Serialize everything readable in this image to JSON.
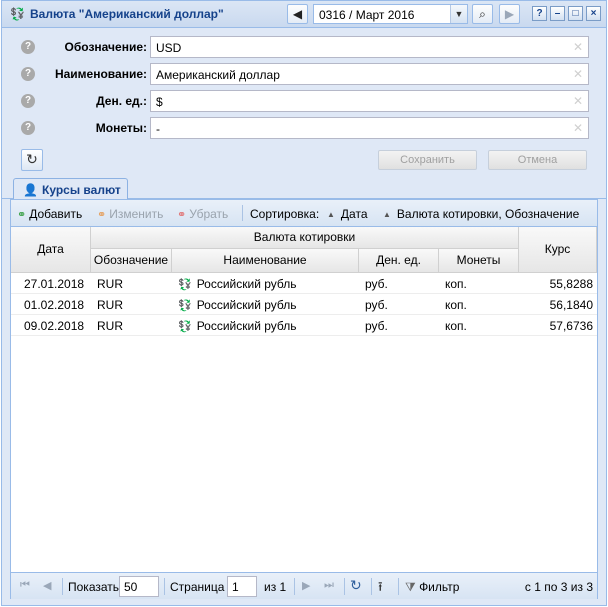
{
  "window": {
    "title": "Валюта \"Американский доллар\"",
    "period": "0316 / Март 2016"
  },
  "form": {
    "fields": [
      {
        "label": "Обозначение:",
        "value": "USD"
      },
      {
        "label": "Наименование:",
        "value": "Американский доллар"
      },
      {
        "label": "Ден. ед.:",
        "value": "$"
      },
      {
        "label": "Монеты:",
        "value": "-"
      }
    ],
    "save_label": "Сохранить",
    "cancel_label": "Отмена"
  },
  "tab": {
    "label": "Курсы валют"
  },
  "toolbar": {
    "add_label": "Добавить",
    "edit_label": "Изменить",
    "remove_label": "Убрать",
    "sort_label": "Сортировка:",
    "sort_items": [
      "Дата",
      "Валюта котировки, Обозначение"
    ]
  },
  "grid": {
    "headers": {
      "date": "Дата",
      "group": "Валюта котировки",
      "code": "Обозначение",
      "name": "Наименование",
      "unit": "Ден. ед.",
      "coins": "Монеты",
      "rate": "Курс"
    },
    "rows": [
      {
        "date": "27.01.2018",
        "code": "RUR",
        "name": "Российский рубль",
        "unit": "руб.",
        "coins": "коп.",
        "rate": "55,8288"
      },
      {
        "date": "01.02.2018",
        "code": "RUR",
        "name": "Российский рубль",
        "unit": "руб.",
        "coins": "коп.",
        "rate": "56,1840"
      },
      {
        "date": "09.02.2018",
        "code": "RUR",
        "name": "Российский рубль",
        "unit": "руб.",
        "coins": "коп.",
        "rate": "57,6736"
      }
    ]
  },
  "paging": {
    "show_label": "Показать",
    "page_size": "50",
    "page_label": "Страница",
    "page": "1",
    "of_label": "из 1",
    "filter_label": "Фильтр",
    "summary": "с 1 по 3 из 3"
  }
}
